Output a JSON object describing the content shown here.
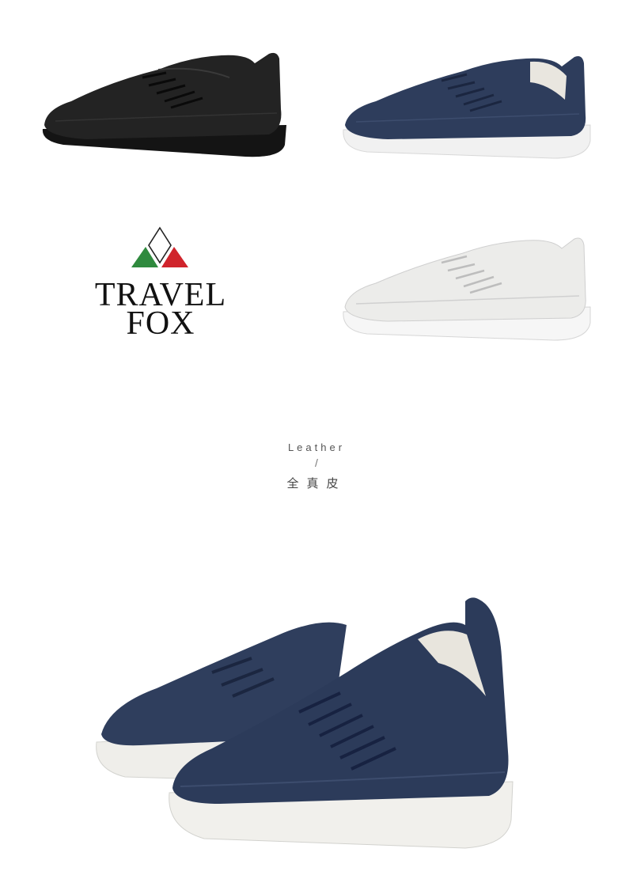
{
  "brand": {
    "line1": "TRAVEL",
    "line2": "FOX",
    "colors": {
      "green": "#2f8a3e",
      "red": "#d0242c",
      "outline": "#222222"
    }
  },
  "caption": {
    "english": "Leather",
    "divider": "/",
    "chinese": "全真皮"
  },
  "products": [
    {
      "variant": "black",
      "upper": "#1c1c1c",
      "sole": "#1a1a1a"
    },
    {
      "variant": "navy",
      "upper": "#2e3d5c",
      "sole": "#f2f2f2"
    },
    {
      "variant": "white",
      "upper": "#eeeeee",
      "sole": "#f6f6f6"
    },
    {
      "variant": "navy-pair",
      "upper": "#2c3b5a",
      "sole": "#f0f0ee"
    }
  ]
}
